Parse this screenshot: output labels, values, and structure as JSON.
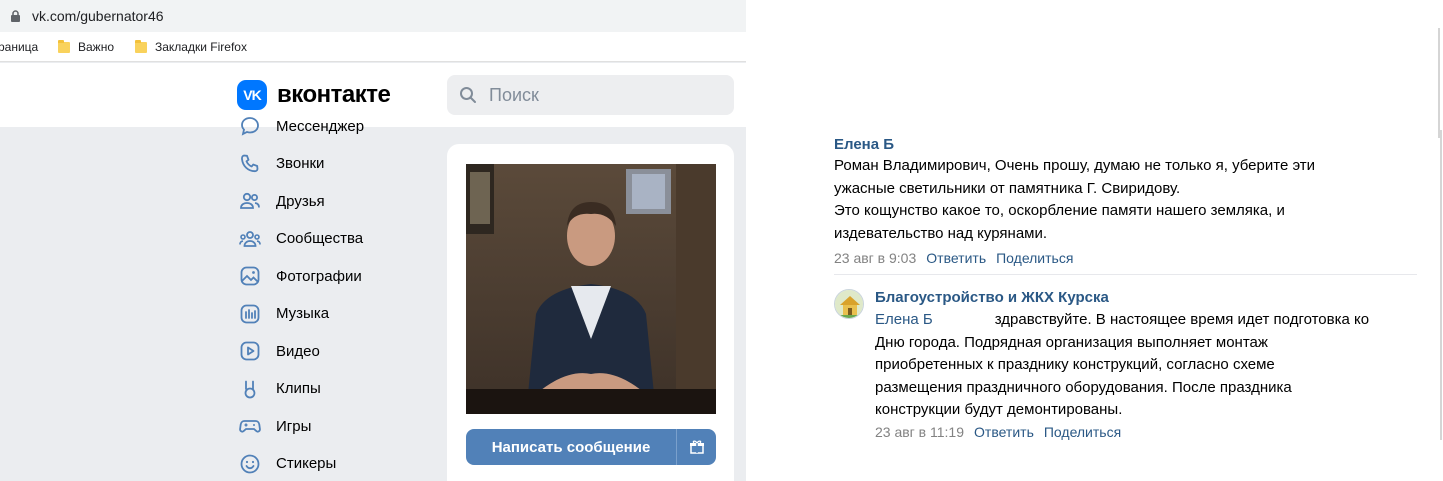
{
  "browser": {
    "url": "vk.com/gubernator46",
    "bookmarks": [
      "раница",
      "Важно",
      "Закладки Firefox"
    ]
  },
  "vk": {
    "logo_text": "вконтакте",
    "logo_badge": "VK",
    "search_placeholder": "Поиск",
    "menu": [
      {
        "label": "Мессенджер",
        "icon": "messenger-icon"
      },
      {
        "label": "Звонки",
        "icon": "phone-icon"
      },
      {
        "label": "Друзья",
        "icon": "friends-icon"
      },
      {
        "label": "Сообщества",
        "icon": "communities-icon"
      },
      {
        "label": "Фотографии",
        "icon": "photos-icon"
      },
      {
        "label": "Музыка",
        "icon": "music-icon"
      },
      {
        "label": "Видео",
        "icon": "video-icon"
      },
      {
        "label": "Клипы",
        "icon": "clips-icon"
      },
      {
        "label": "Игры",
        "icon": "games-icon"
      },
      {
        "label": "Стикеры",
        "icon": "stickers-icon"
      }
    ],
    "profile": {
      "write_message": "Написать сообщение",
      "gift_icon": "gift-icon"
    },
    "colors": {
      "accent": "#0077ff",
      "button": "#5181b8",
      "link": "#2a5885"
    }
  },
  "comments": {
    "first": {
      "author": "Елена Б",
      "lines": [
        "Роман Владимирович, Очень прошу, думаю не только я, уберите эти",
        "ужасные светильники от памятника Г. Свиридову.",
        "Это кощунство какое то, оскорбление памяти нашего земляка, и",
        "издевательство над курянами."
      ],
      "time": "23 авг в 9:03",
      "reply": "Ответить",
      "share": "Поделиться"
    },
    "second": {
      "author": "Благоустройство и ЖКХ Курска",
      "mention": "Елена Б",
      "first_line_rest": "здравствуйте. В настоящее время идет подготовка ко",
      "lines": [
        "Дню города. Подрядная организация выполняет монтаж",
        "приобретенных к празднику конструкций, согласно схеме",
        "размещения праздничного оборудования. После праздника",
        "конструкции будут демонтированы."
      ],
      "time": "23 авг в 11:19",
      "reply": "Ответить",
      "share": "Поделиться"
    }
  }
}
